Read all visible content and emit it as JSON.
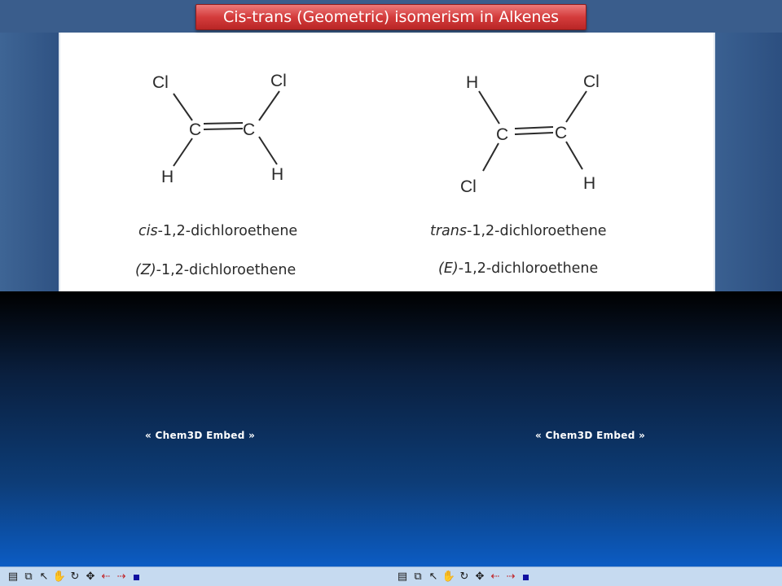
{
  "slide": {
    "title": "Cis-trans (Geometric) isomerism  in Alkenes"
  },
  "molecules": [
    {
      "atoms": {
        "top_left": "Cl",
        "top_right": "Cl",
        "c_left": "C",
        "c_right": "C",
        "bottom_left": "H",
        "bottom_right": "H"
      },
      "name_prefix": "cis",
      "name_suffix": "-1,2-dichloroethene",
      "ez_prefix": "(Z)",
      "ez_suffix": "-1,2-dichloroethene"
    },
    {
      "atoms": {
        "top_left": "H",
        "top_right": "Cl",
        "c_left": "C",
        "c_right": "C",
        "bottom_left": "Cl",
        "bottom_right": "H"
      },
      "name_prefix": "trans",
      "name_suffix": "-1,2-dichloroethene",
      "ez_prefix": "(E)",
      "ez_suffix": "-1,2-dichloroethene"
    }
  ],
  "embeds": {
    "left_label": "« Chem3D Embed »",
    "right_label": "« Chem3D Embed »"
  },
  "toolbar": {
    "icons": [
      "document-icon",
      "molecule-icon",
      "pointer-icon",
      "hand-icon",
      "rotate-icon",
      "translate-icon",
      "bond-left-icon",
      "bond-right-icon",
      "stop-icon"
    ]
  },
  "colors": {
    "title_bar": "#d43c3c",
    "panel": "#ffffff",
    "side": "#3a5d8c",
    "embed_area": "#0d3d78",
    "toolbar": "#c6daf0"
  }
}
